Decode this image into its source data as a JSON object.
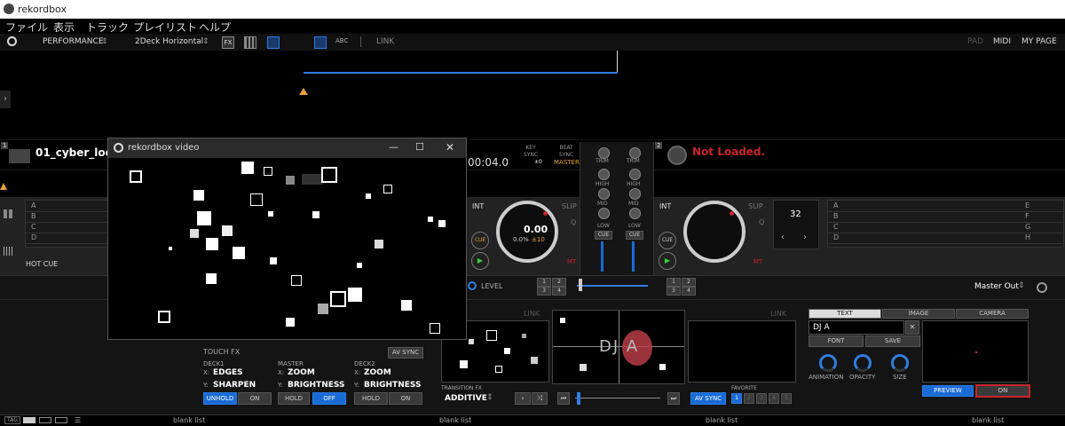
{
  "window": {
    "title": "rekordbox"
  },
  "menu": [
    "ファイル",
    "表示",
    "トラック",
    "プレイリスト",
    "ヘルプ"
  ],
  "toolbar": {
    "mode": "PERFORMANCE",
    "layout": "2Deck Horizontal",
    "fx": "FX",
    "abc": "ABC",
    "link": "LINK",
    "pad": "PAD",
    "midi": "MIDI",
    "mypage": "MY PAGE"
  },
  "deck1": {
    "number": "1",
    "track": "01_cyber_loop",
    "time": "00:04.0",
    "key_sync_label": "KEY\nSYNC",
    "key_value": "±0",
    "beat_sync_label": "BEAT\nSYNC",
    "master": "MASTER",
    "int": "INT",
    "slip": "SLIP",
    "q": "Q",
    "cue": "CUE",
    "mt": "MT",
    "bpm_display": "0.00",
    "pitch": "0.0%",
    "range": "±10",
    "hotcue_label": "HOT CUE",
    "pads": [
      "A",
      "B",
      "C",
      "D"
    ]
  },
  "deck2": {
    "number": "2",
    "status": "Not Loaded.",
    "int": "INT",
    "slip": "SLIP",
    "q": "Q",
    "cue": "CUE",
    "mt": "MT",
    "beat": "32",
    "pads_left": [
      "A",
      "B",
      "C",
      "D"
    ],
    "pads_right": [
      "E",
      "F",
      "G",
      "H"
    ]
  },
  "mixer": {
    "trim": "TRIM",
    "high": "HIGH",
    "mid": "MID",
    "low": "LOW",
    "cue": "CUE",
    "level": "LEVEL",
    "master_out": "Master Out",
    "ch_buttons_left": [
      "1",
      "2",
      "3",
      "4"
    ],
    "ch_buttons_right": [
      "1",
      "2",
      "3",
      "4"
    ]
  },
  "video_window": {
    "title": "rekordbox video"
  },
  "touch_fx": {
    "title": "TOUCH FX",
    "av_sync": "AV SYNC",
    "deck1_label": "DECK1",
    "master_label": "MASTER",
    "deck2_label": "DECK2",
    "deck1_x": "EDGES",
    "deck1_y": "SHARPEN",
    "master_x": "ZOOM",
    "master_y": "BRIGHTNESS",
    "deck2_x": "ZOOM",
    "deck2_y": "BRIGHTNESS",
    "x_label": "X:",
    "y_label": "Y:",
    "unhold": "UNHOLD",
    "on": "ON",
    "hold": "HOLD",
    "off": "OFF"
  },
  "transition": {
    "link_left": "LINK",
    "link_right": "LINK",
    "label": "TRANSITION FX",
    "value": "ADDITIVE",
    "av_sync": "AV SYNC",
    "favorite": "FAVORITE",
    "favorites": [
      "1",
      "2",
      "3",
      "4",
      "5"
    ]
  },
  "text_panel": {
    "tab_text": "TEXT",
    "tab_image": "IMAGE",
    "tab_camera": "CAMERA",
    "text_value": "DJ  A",
    "font": "FONT",
    "save": "SAVE",
    "animation": "ANIMATION",
    "opacity": "OPACITY",
    "size": "SIZE",
    "preview": "PREVIEW",
    "on": "ON"
  },
  "preview_text": "DJ  A",
  "browser": {
    "tag": "TAG",
    "lists": [
      "blank list",
      "blank list",
      "blank list",
      "blank list"
    ]
  },
  "colors": {
    "accent": "#1a6bd6",
    "red": "#c8232c",
    "orange": "#e8a13a"
  }
}
